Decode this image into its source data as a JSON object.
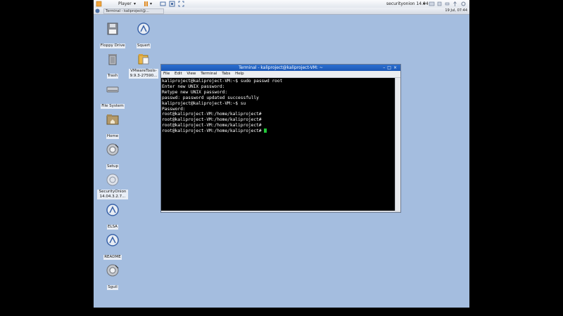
{
  "player": {
    "menu_label": "Player",
    "vm_name": "securityonion 14.04"
  },
  "taskbar": {
    "task_label": "Terminal - kaliproject@...",
    "clock": "19 Jul, 07:44"
  },
  "desktop_icons": [
    {
      "label": "Floppy Drive"
    },
    {
      "label": "Squert"
    },
    {
      "label": "Trash"
    },
    {
      "label": "VMwareTools-9.9.3-27590..."
    },
    {
      "label": "File System"
    },
    {
      "label": "Home"
    },
    {
      "label": "Setup"
    },
    {
      "label": "SecurityOnion 14.04.3.2.7..."
    },
    {
      "label": "ELSA"
    },
    {
      "label": "README"
    },
    {
      "label": "Sguil"
    }
  ],
  "terminal": {
    "title": "Terminal - kaliproject@kaliproject-VM: ~",
    "menu": [
      "File",
      "Edit",
      "View",
      "Terminal",
      "Tabs",
      "Help"
    ],
    "lines": [
      "kaliproject@kaliproject-VM:~$ sudo passwd root",
      "Enter new UNIX password:",
      "Retype new UNIX password:",
      "passwd: password updated successfully",
      "kaliproject@kaliproject-VM:~$ su",
      "Password:",
      "root@kaliproject-VM:/home/kaliproject#",
      "root@kaliproject-VM:/home/kaliproject#",
      "root@kaliproject-VM:/home/kaliproject#",
      "root@kaliproject-VM:/home/kaliproject# "
    ]
  },
  "colors": {
    "desktop_bg": "#a4bddf",
    "titlebar": "#2b6fd0",
    "cursor": "#22c83a"
  }
}
